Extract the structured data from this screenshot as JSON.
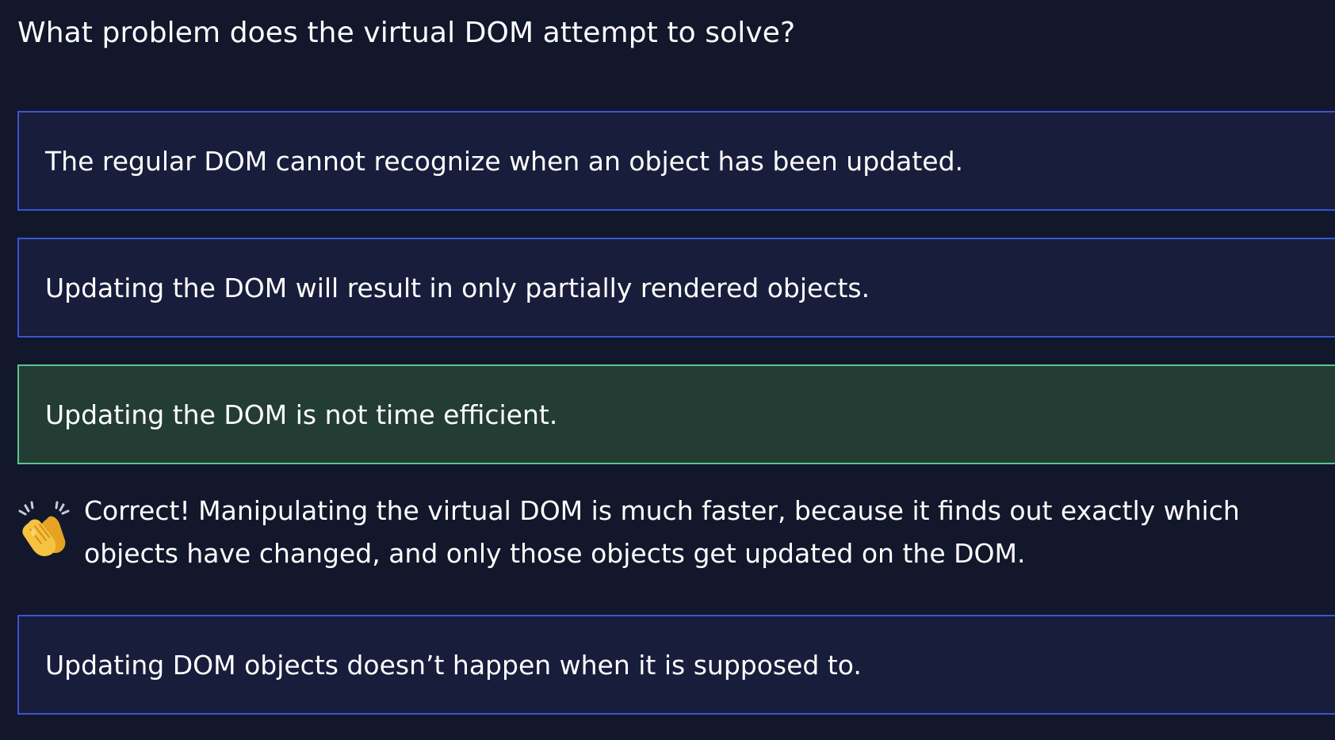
{
  "question": {
    "text": "What problem does the virtual DOM attempt to solve?"
  },
  "options": [
    {
      "text": "The regular DOM cannot recognize when an object has been updated.",
      "state": "default"
    },
    {
      "text": "Updating the DOM will result in only partially rendered objects.",
      "state": "default"
    },
    {
      "text": "Updating the DOM is not time efficient.",
      "state": "correct"
    },
    {
      "text": "Updating DOM objects doesn’t happen when it is supposed to.",
      "state": "default"
    }
  ],
  "feedback": {
    "icon": "clapping-hands-icon",
    "text": "Correct! Manipulating the virtual DOM is much faster, because it finds out exactly which objects have changed, and only those objects get updated on the DOM."
  },
  "colors": {
    "background": "#12172b",
    "option_border": "#3a55d1",
    "option_background": "#171d3b",
    "correct_border": "#5ec48f",
    "correct_background": "#233d34"
  }
}
